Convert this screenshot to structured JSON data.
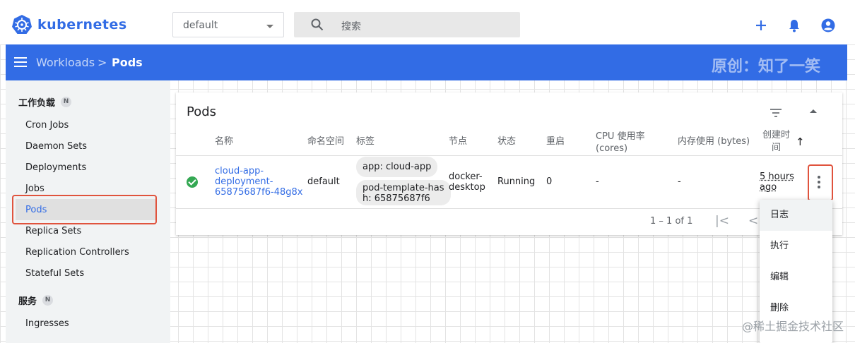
{
  "topbar": {
    "brand": "kubernetes",
    "namespace_value": "default",
    "search_placeholder": "搜索",
    "icons": [
      "plus-icon",
      "bell-icon",
      "account-icon"
    ],
    "accent_color": "#326ce5"
  },
  "header": {
    "breadcrumb": [
      "Workloads",
      "Pods"
    ],
    "separator": ">",
    "watermark": "原创：知了一笑"
  },
  "sidebar": {
    "categories": [
      {
        "label": "工作负载",
        "badge": "N"
      },
      {
        "label": "服务",
        "badge": "N"
      }
    ],
    "items": [
      {
        "label": "Cron Jobs"
      },
      {
        "label": "Daemon Sets"
      },
      {
        "label": "Deployments"
      },
      {
        "label": "Jobs"
      },
      {
        "label": "Pods",
        "active": true
      },
      {
        "label": "Replica Sets"
      },
      {
        "label": "Replication Controllers"
      },
      {
        "label": "Stateful Sets"
      },
      {
        "label": "Ingresses"
      }
    ]
  },
  "pods_card": {
    "title": "Pods",
    "columns": {
      "name": "名称",
      "namespace": "命名空间",
      "labels": "标签",
      "node": "节点",
      "status": "状态",
      "restarts": "重启",
      "cpu_line1": "CPU 使用率",
      "cpu_line2": "(cores)",
      "memory": "内存使用 (bytes)",
      "created_line1": "创建时",
      "created_line2": "间",
      "sort_arrow": "↑"
    },
    "rows": [
      {
        "status_icon": "check-circle-icon",
        "name_lines": [
          "cloud-app-",
          "deployment-",
          "65875687f6-48g8x"
        ],
        "namespace": "default",
        "labels": [
          {
            "lines": [
              "app: cloud-app"
            ]
          },
          {
            "lines": [
              "pod-template-has",
              "h: 65875687f6"
            ]
          }
        ],
        "node_lines": [
          "docker-",
          "desktop"
        ],
        "status": "Running",
        "restarts": "0",
        "cpu": "-",
        "memory": "-",
        "created_lines": [
          "5 hours",
          "ago"
        ]
      }
    ],
    "pagination": "1 – 1 of 1",
    "first_page_glyph": "|<",
    "prev_page_glyph": "<"
  },
  "context_menu": {
    "items": [
      "日志",
      "执行",
      "编辑",
      "删除"
    ]
  },
  "site_watermark": "@稀土掘金技术社区"
}
